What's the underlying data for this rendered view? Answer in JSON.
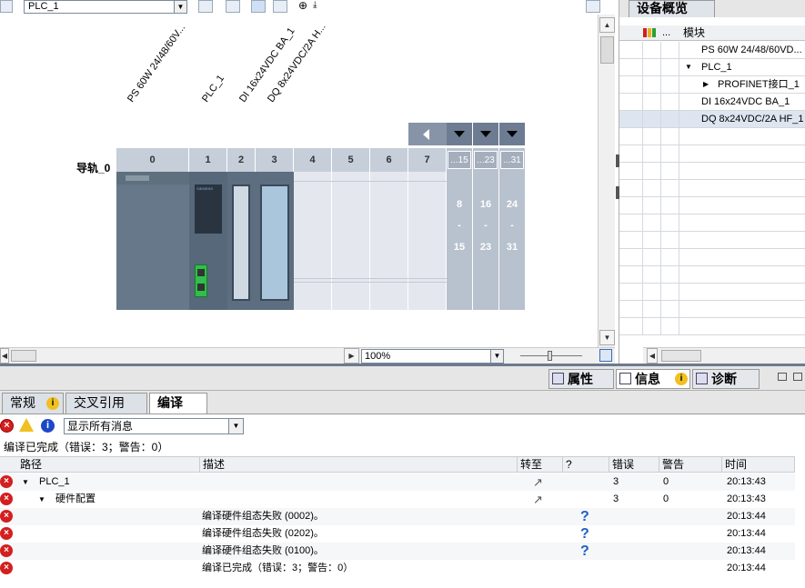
{
  "toolbar": {
    "device_select": "PLC_1"
  },
  "rack": {
    "rail_label": "导轨_0",
    "module_labels": [
      "PS 60W 24/48/60V...",
      "PLC_1",
      "DI 16x24VDC BA_1",
      "DQ 8x24VDC/2A H..."
    ],
    "slots": [
      "0",
      "1",
      "2",
      "3",
      "4",
      "5",
      "6",
      "7"
    ],
    "ext_headers": [
      "...15",
      "...23",
      "...31"
    ],
    "ext_ranges": [
      {
        "start": "8",
        "dash": "-",
        "end": "15"
      },
      {
        "start": "16",
        "dash": "-",
        "end": "23"
      },
      {
        "start": "24",
        "dash": "-",
        "end": "31"
      }
    ],
    "module_brand": "SIEMENS"
  },
  "zoom": {
    "value": "100%"
  },
  "overview": {
    "tab_title": "设备概览",
    "header_dots": "...",
    "header_module": "模块",
    "rows": [
      {
        "label": "PS 60W 24/48/60VD...",
        "arrow": ""
      },
      {
        "label": "PLC_1",
        "arrow": "▼"
      },
      {
        "label": "PROFINET接口_1",
        "arrow": "▶"
      },
      {
        "label": "DI 16x24VDC BA_1",
        "arrow": ""
      },
      {
        "label": "DQ 8x24VDC/2A HF_1",
        "arrow": ""
      }
    ]
  },
  "inspector_tabs": {
    "properties": "属性",
    "info": "信息",
    "diagnostics": "诊断"
  },
  "sub_tabs": {
    "general": "常规",
    "cross_ref": "交叉引用",
    "compile": "编译"
  },
  "filter": {
    "select": "显示所有消息"
  },
  "summary": "编译已完成（错误：3；警告：0）",
  "msg_headers": {
    "path": "路径",
    "desc": "描述",
    "goto": "转至",
    "help": "?",
    "errors": "错误",
    "warnings": "警告",
    "time": "时间"
  },
  "messages": [
    {
      "path": "PLC_1",
      "arrow": "▼",
      "indent": 0,
      "desc": "",
      "goto": "↗",
      "help": "",
      "errors": "3",
      "warnings": "0",
      "time": "20:13:43"
    },
    {
      "path": "硬件配置",
      "arrow": "▼",
      "indent": 1,
      "desc": "",
      "goto": "↗",
      "help": "",
      "errors": "3",
      "warnings": "0",
      "time": "20:13:43"
    },
    {
      "path": "",
      "arrow": "",
      "indent": 0,
      "desc": "编译硬件组态失败 (0002)。",
      "goto": "",
      "help": "?",
      "errors": "",
      "warnings": "",
      "time": "20:13:44"
    },
    {
      "path": "",
      "arrow": "",
      "indent": 0,
      "desc": "编译硬件组态失败 (0202)。",
      "goto": "",
      "help": "?",
      "errors": "",
      "warnings": "",
      "time": "20:13:44"
    },
    {
      "path": "",
      "arrow": "",
      "indent": 0,
      "desc": "编译硬件组态失败 (0100)。",
      "goto": "",
      "help": "?",
      "errors": "",
      "warnings": "",
      "time": "20:13:44"
    },
    {
      "path": "",
      "arrow": "",
      "indent": 0,
      "desc": "编译已完成（错误：3；警告：0）",
      "goto": "",
      "help": "",
      "errors": "",
      "warnings": "",
      "time": "20:13:44"
    }
  ]
}
